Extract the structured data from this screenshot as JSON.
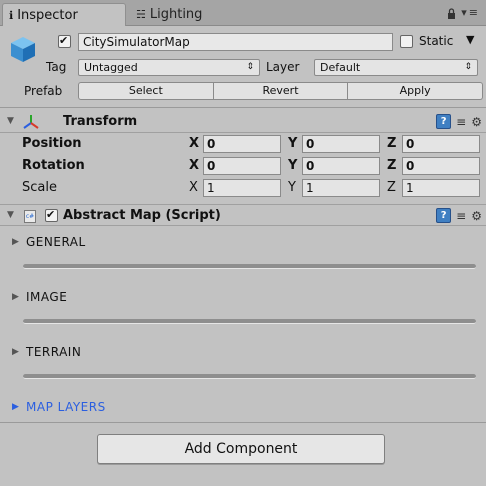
{
  "tabs": {
    "inspector": {
      "icon": "ℹ",
      "label": "Inspector"
    },
    "lighting": {
      "icon": "☵",
      "label": "Lighting"
    },
    "lock_icon": "lock-icon",
    "menu_icon": "▾≡"
  },
  "header": {
    "object_name": "CitySimulatorMap",
    "active": true,
    "static_label": "Static",
    "static_checked": false,
    "tag_label": "Tag",
    "tag_value": "Untagged",
    "layer_label": "Layer",
    "layer_value": "Default",
    "prefab_label": "Prefab",
    "prefab_buttons": {
      "select": "Select",
      "revert": "Revert",
      "apply": "Apply"
    }
  },
  "transform": {
    "title": "Transform",
    "rows": [
      {
        "label": "Position",
        "x": "0",
        "y": "0",
        "z": "0"
      },
      {
        "label": "Rotation",
        "x": "0",
        "y": "0",
        "z": "0"
      },
      {
        "label": "Scale",
        "x": "1",
        "y": "1",
        "z": "1"
      }
    ],
    "axes": {
      "x": "X",
      "y": "Y",
      "z": "Z"
    }
  },
  "script": {
    "title": "Abstract Map (Script)",
    "enabled": true,
    "sections": [
      {
        "label": "GENERAL"
      },
      {
        "label": "IMAGE"
      },
      {
        "label": "TERRAIN"
      },
      {
        "label": "MAP LAYERS"
      }
    ]
  },
  "add_component_label": "Add Component",
  "colors": {
    "accent_link": "#2b5fe0",
    "panel_bg": "#c2c2c2",
    "help_icon": "#3f7fc2"
  }
}
